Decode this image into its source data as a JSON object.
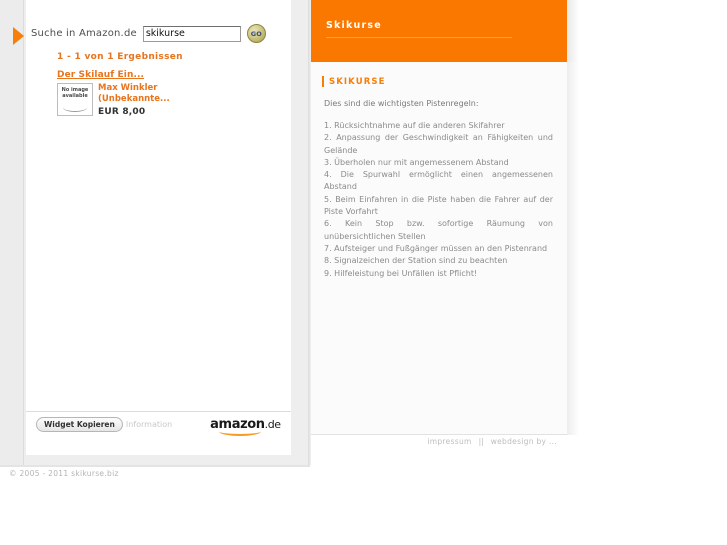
{
  "widget": {
    "search_label": "Suche in Amazon.de",
    "search_value": "skikurse",
    "search_placeholder": "",
    "go_label": "GO",
    "results_count": "1 - 1 von 1 Ergebnissen",
    "product": {
      "title": "Der Skilauf Ein...",
      "no_image_line1": "No image",
      "no_image_line2": "available",
      "author": "Max Winkler (Unbekannte...",
      "price": "EUR 8,00"
    },
    "footer": {
      "copy_button": "Widget Kopieren",
      "information": "Information",
      "brand": "amazon",
      "brand_tld": ".de"
    }
  },
  "header": {
    "title": "Skikurse"
  },
  "content": {
    "section_title": "SKIKURSE",
    "intro": "Dies sind die wichtigsten Pistenregeln:",
    "rules": [
      "1. Rücksichtnahme auf die anderen Skifahrer",
      "2. Anpassung der Geschwindigkeit an Fähigkeiten und Gelände",
      "3. Überholen nur mit angemessenem Abstand",
      "4. Die Spurwahl ermöglicht einen angemessenen Abstand",
      "5. Beim Einfahren in die Piste haben die Fahrer auf der Piste Vorfahrt",
      "6. Kein Stop bzw. sofortige Räumung von unübersichtlichen Stellen",
      "7. Aufsteiger und Fußgänger müssen an den Pistenrand",
      "8. Signalzeichen der Station sind zu beachten",
      "9. Hilfeleistung bei Unfällen ist Pflicht!"
    ]
  },
  "page_footer": {
    "impressum": "impressum",
    "separator": "||",
    "webdesign": "webdesign by ...",
    "copyright": "© 2005 - 2011 skikurse.biz"
  },
  "colors": {
    "brand_orange": "#fb7800",
    "accent_orange": "#f77f09",
    "link_orange": "#e8741c",
    "panel_grey": "#eeeeee",
    "text_grey": "#8b8b8b"
  }
}
